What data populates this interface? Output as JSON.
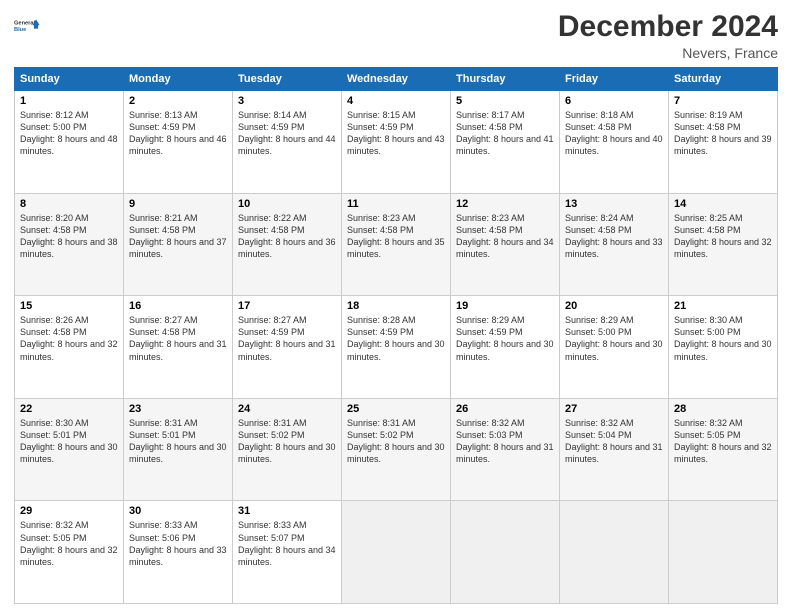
{
  "header": {
    "logo_line1": "General",
    "logo_line2": "Blue",
    "month_title": "December 2024",
    "location": "Nevers, France"
  },
  "weekdays": [
    "Sunday",
    "Monday",
    "Tuesday",
    "Wednesday",
    "Thursday",
    "Friday",
    "Saturday"
  ],
  "weeks": [
    [
      {
        "day": "1",
        "sunrise": "8:12 AM",
        "sunset": "5:00 PM",
        "daylight": "8 hours and 48 minutes."
      },
      {
        "day": "2",
        "sunrise": "8:13 AM",
        "sunset": "4:59 PM",
        "daylight": "8 hours and 46 minutes."
      },
      {
        "day": "3",
        "sunrise": "8:14 AM",
        "sunset": "4:59 PM",
        "daylight": "8 hours and 44 minutes."
      },
      {
        "day": "4",
        "sunrise": "8:15 AM",
        "sunset": "4:59 PM",
        "daylight": "8 hours and 43 minutes."
      },
      {
        "day": "5",
        "sunrise": "8:17 AM",
        "sunset": "4:58 PM",
        "daylight": "8 hours and 41 minutes."
      },
      {
        "day": "6",
        "sunrise": "8:18 AM",
        "sunset": "4:58 PM",
        "daylight": "8 hours and 40 minutes."
      },
      {
        "day": "7",
        "sunrise": "8:19 AM",
        "sunset": "4:58 PM",
        "daylight": "8 hours and 39 minutes."
      }
    ],
    [
      {
        "day": "8",
        "sunrise": "8:20 AM",
        "sunset": "4:58 PM",
        "daylight": "8 hours and 38 minutes."
      },
      {
        "day": "9",
        "sunrise": "8:21 AM",
        "sunset": "4:58 PM",
        "daylight": "8 hours and 37 minutes."
      },
      {
        "day": "10",
        "sunrise": "8:22 AM",
        "sunset": "4:58 PM",
        "daylight": "8 hours and 36 minutes."
      },
      {
        "day": "11",
        "sunrise": "8:23 AM",
        "sunset": "4:58 PM",
        "daylight": "8 hours and 35 minutes."
      },
      {
        "day": "12",
        "sunrise": "8:23 AM",
        "sunset": "4:58 PM",
        "daylight": "8 hours and 34 minutes."
      },
      {
        "day": "13",
        "sunrise": "8:24 AM",
        "sunset": "4:58 PM",
        "daylight": "8 hours and 33 minutes."
      },
      {
        "day": "14",
        "sunrise": "8:25 AM",
        "sunset": "4:58 PM",
        "daylight": "8 hours and 32 minutes."
      }
    ],
    [
      {
        "day": "15",
        "sunrise": "8:26 AM",
        "sunset": "4:58 PM",
        "daylight": "8 hours and 32 minutes."
      },
      {
        "day": "16",
        "sunrise": "8:27 AM",
        "sunset": "4:58 PM",
        "daylight": "8 hours and 31 minutes."
      },
      {
        "day": "17",
        "sunrise": "8:27 AM",
        "sunset": "4:59 PM",
        "daylight": "8 hours and 31 minutes."
      },
      {
        "day": "18",
        "sunrise": "8:28 AM",
        "sunset": "4:59 PM",
        "daylight": "8 hours and 30 minutes."
      },
      {
        "day": "19",
        "sunrise": "8:29 AM",
        "sunset": "4:59 PM",
        "daylight": "8 hours and 30 minutes."
      },
      {
        "day": "20",
        "sunrise": "8:29 AM",
        "sunset": "5:00 PM",
        "daylight": "8 hours and 30 minutes."
      },
      {
        "day": "21",
        "sunrise": "8:30 AM",
        "sunset": "5:00 PM",
        "daylight": "8 hours and 30 minutes."
      }
    ],
    [
      {
        "day": "22",
        "sunrise": "8:30 AM",
        "sunset": "5:01 PM",
        "daylight": "8 hours and 30 minutes."
      },
      {
        "day": "23",
        "sunrise": "8:31 AM",
        "sunset": "5:01 PM",
        "daylight": "8 hours and 30 minutes."
      },
      {
        "day": "24",
        "sunrise": "8:31 AM",
        "sunset": "5:02 PM",
        "daylight": "8 hours and 30 minutes."
      },
      {
        "day": "25",
        "sunrise": "8:31 AM",
        "sunset": "5:02 PM",
        "daylight": "8 hours and 30 minutes."
      },
      {
        "day": "26",
        "sunrise": "8:32 AM",
        "sunset": "5:03 PM",
        "daylight": "8 hours and 31 minutes."
      },
      {
        "day": "27",
        "sunrise": "8:32 AM",
        "sunset": "5:04 PM",
        "daylight": "8 hours and 31 minutes."
      },
      {
        "day": "28",
        "sunrise": "8:32 AM",
        "sunset": "5:05 PM",
        "daylight": "8 hours and 32 minutes."
      }
    ],
    [
      {
        "day": "29",
        "sunrise": "8:32 AM",
        "sunset": "5:05 PM",
        "daylight": "8 hours and 32 minutes."
      },
      {
        "day": "30",
        "sunrise": "8:33 AM",
        "sunset": "5:06 PM",
        "daylight": "8 hours and 33 minutes."
      },
      {
        "day": "31",
        "sunrise": "8:33 AM",
        "sunset": "5:07 PM",
        "daylight": "8 hours and 34 minutes."
      },
      null,
      null,
      null,
      null
    ]
  ],
  "labels": {
    "sunrise": "Sunrise:",
    "sunset": "Sunset:",
    "daylight": "Daylight:"
  }
}
